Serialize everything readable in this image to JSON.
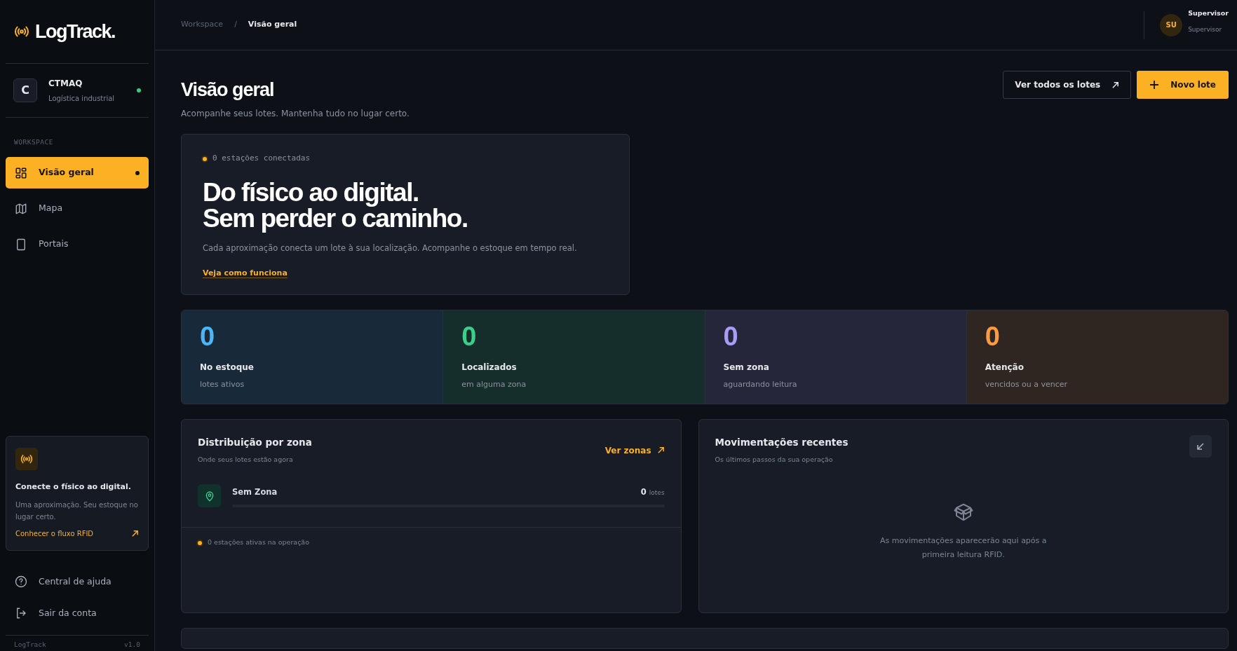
{
  "brand": {
    "name": "LogTrack."
  },
  "org": {
    "initial": "C",
    "name": "CTMAQ",
    "subtitle": "Logística industrial",
    "online": true
  },
  "nav_section": "WORKSPACE",
  "nav": [
    {
      "label": "Visão geral",
      "selected": true
    },
    {
      "label": "Mapa",
      "selected": false
    },
    {
      "label": "Portais",
      "selected": false
    }
  ],
  "promo": {
    "title": "Conecte o físico ao digital.",
    "text": "Uma aproximação. Seu estoque no lugar certo.",
    "link": "Conhecer o fluxo RFID"
  },
  "footer_links": [
    {
      "label": "Central de ajuda"
    },
    {
      "label": "Sair da conta"
    }
  ],
  "version": {
    "app": "LogTrack",
    "number": "v1.0"
  },
  "breadcrumb_separator": "/",
  "breadcrumb": [
    {
      "label": "Workspace",
      "selected": false
    },
    {
      "label": "Visão geral",
      "selected": true
    }
  ],
  "user": {
    "initials": "SU",
    "name": "Supervisor",
    "role": "Supervisor"
  },
  "page": {
    "title": "Visão geral",
    "subtitle": "Acompanhe seus lotes. Mantenha tudo no lugar certo."
  },
  "actions": [
    {
      "label": "Ver todos os lotes",
      "kind": "outline"
    },
    {
      "label": "Novo lote",
      "kind": "primary"
    }
  ],
  "hero": {
    "status": "0 estações conectadas",
    "headline": [
      "Do físico ao digital.",
      "Sem perder o caminho."
    ],
    "text": "Cada aproximação conecta um lote à sua localização. Acompanhe o estoque em tempo real.",
    "link": "Veja como funciona"
  },
  "stats": [
    {
      "value": "0",
      "label": "No estoque",
      "caption": "lotes ativos",
      "color": "#4db5f7"
    },
    {
      "value": "0",
      "label": "Localizados",
      "caption": "em alguma zona",
      "color": "#3ccf8a"
    },
    {
      "value": "0",
      "label": "Sem zona",
      "caption": "aguardando leitura",
      "color": "#a99cf7"
    },
    {
      "value": "0",
      "label": "Atenção",
      "caption": "vencidos ou a vencer",
      "color": "#f99a44"
    }
  ],
  "zones": {
    "title": "Distribuição por zona",
    "subtitle": "Onde seus lotes estão agora",
    "link": "Ver zonas",
    "items": [
      {
        "name": "Sem Zona",
        "count": "0",
        "unit": "lotes",
        "level": 0
      }
    ],
    "footer": "0 estações ativas na operação"
  },
  "movements": {
    "title": "Movimentações recentes",
    "subtitle": "Os últimos passos da sua operação",
    "empty": "As movimentações aparecerão aqui após a primeira leitura RFID."
  }
}
